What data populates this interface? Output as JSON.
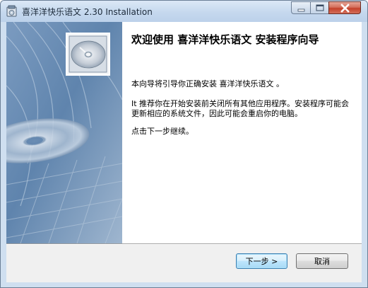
{
  "window": {
    "title": "喜洋洋快乐语文 2.30 Installation"
  },
  "welcome": {
    "heading": "欢迎使用 喜洋洋快乐语文 安装程序向导",
    "paragraph_1": "本向导将引导你正确安装 喜洋洋快乐语文 。",
    "paragraph_2": "It 推荐你在开始安装前关闭所有其他应用程序。安装程序可能会更新相应的系统文件，因此可能会重启你的电脑。",
    "paragraph_3": "点击下一步继续。"
  },
  "buttons": {
    "next_label": "下一步 >",
    "cancel_label": "取消"
  },
  "colors": {
    "sidebar_blue": "#5f84ad",
    "next_button_border": "#3c7fb1",
    "close_button": "#c4412a"
  },
  "icons": {
    "app": "installer-icon",
    "disc": "cd-disc-icon"
  }
}
